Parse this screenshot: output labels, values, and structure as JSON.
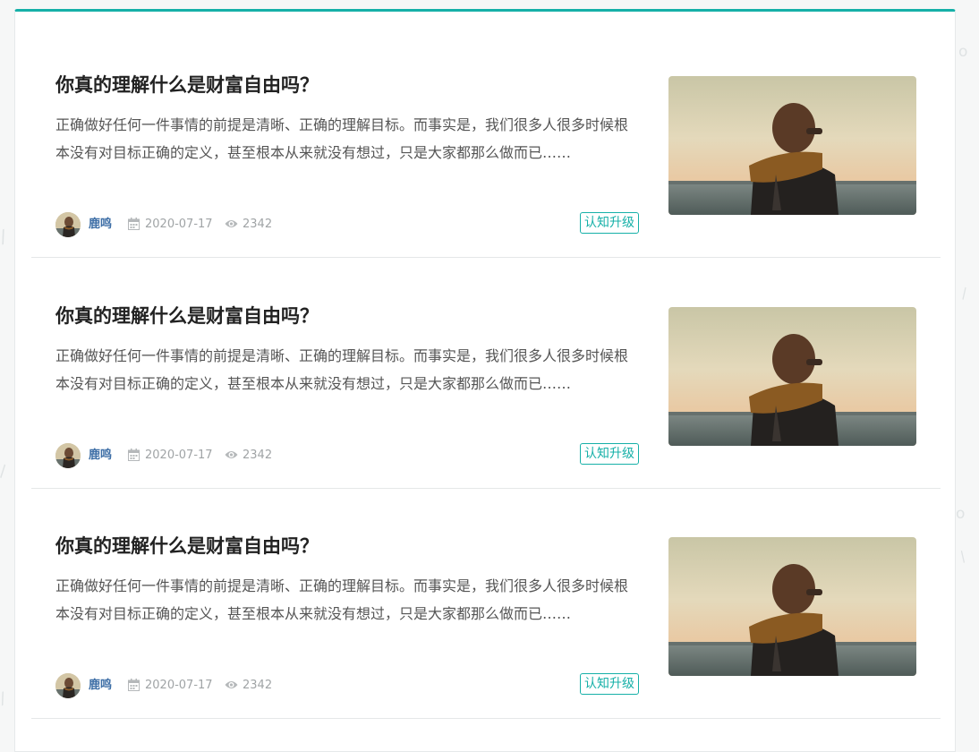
{
  "posts": [
    {
      "title": "你真的理解什么是财富自由吗？",
      "excerpt": "正确做好任何一件事情的前提是清晰、正确的理解目标。而事实是，我们很多人很多时候根本没有对目标正确的定义，甚至根本从来就没有想过，只是大家都那么做而已……",
      "author": "鹿鸣",
      "date": "2020-07-17",
      "views": "2342",
      "tag": "认知升级"
    },
    {
      "title": "你真的理解什么是财富自由吗？",
      "excerpt": "正确做好任何一件事情的前提是清晰、正确的理解目标。而事实是，我们很多人很多时候根本没有对目标正确的定义，甚至根本从来就没有想过，只是大家都那么做而已……",
      "author": "鹿鸣",
      "date": "2020-07-17",
      "views": "2342",
      "tag": "认知升级"
    },
    {
      "title": "你真的理解什么是财富自由吗？",
      "excerpt": "正确做好任何一件事情的前提是清晰、正确的理解目标。而事实是，我们很多人很多时候根本没有对目标正确的定义，甚至根本从来就没有想过，只是大家都那么做而已……",
      "author": "鹿鸣",
      "date": "2020-07-17",
      "views": "2342",
      "tag": "认知升级"
    }
  ],
  "icons": {
    "date": "calendar-icon",
    "views": "eye-icon"
  },
  "colors": {
    "accent": "#16b0a8",
    "author": "#3d6ea6",
    "title": "#222222",
    "text": "#555555",
    "meta": "#a0a4a6"
  }
}
